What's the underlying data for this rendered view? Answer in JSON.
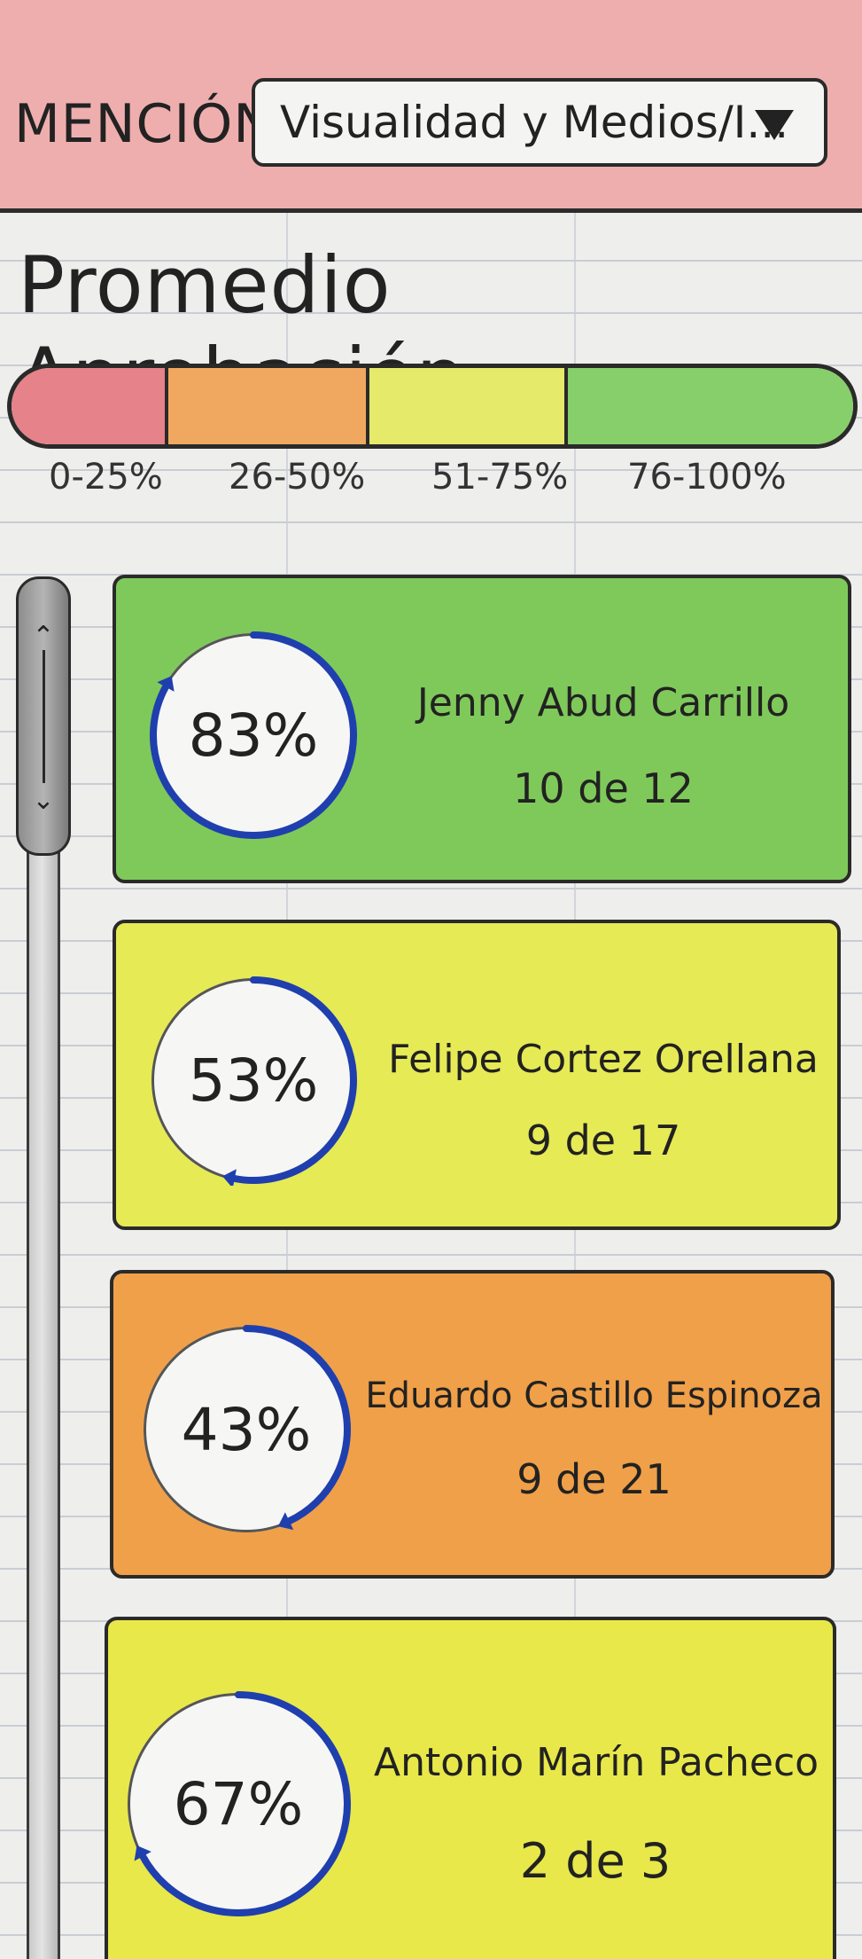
{
  "header": {
    "mention_label": "MENCIÓN",
    "dropdown_value": "Visualidad y Medios/I...",
    "dropdown_icon": "chevron-down-icon",
    "background_color": "#efaeae"
  },
  "title": "Promedio Aprobación",
  "legend": [
    {
      "label": "0-25%",
      "color": "#e5828a"
    },
    {
      "label": "26-50%",
      "color": "#f0a860"
    },
    {
      "label": "51-75%",
      "color": "#e6ea6a"
    },
    {
      "label": "76-100%",
      "color": "#86cf6a"
    }
  ],
  "students": [
    {
      "name": "Jenny Abud Carrillo",
      "percent": "83%",
      "count": "10 de 12",
      "color": "#7fc95a",
      "progress": 0.83
    },
    {
      "name": "Felipe Cortez Orellana",
      "percent": "53%",
      "count": "9 de 17",
      "color": "#e6ea55",
      "progress": 0.53
    },
    {
      "name": "Eduardo Castillo Espinoza",
      "percent": "43%",
      "count": "9 de 21",
      "color": "#f0a048",
      "progress": 0.43
    },
    {
      "name": "Antonio Marín Pacheco",
      "percent": "67%",
      "count": "2 de 3",
      "color": "#e8e84a",
      "progress": 0.67
    }
  ],
  "ring_color": "#1f3fae"
}
